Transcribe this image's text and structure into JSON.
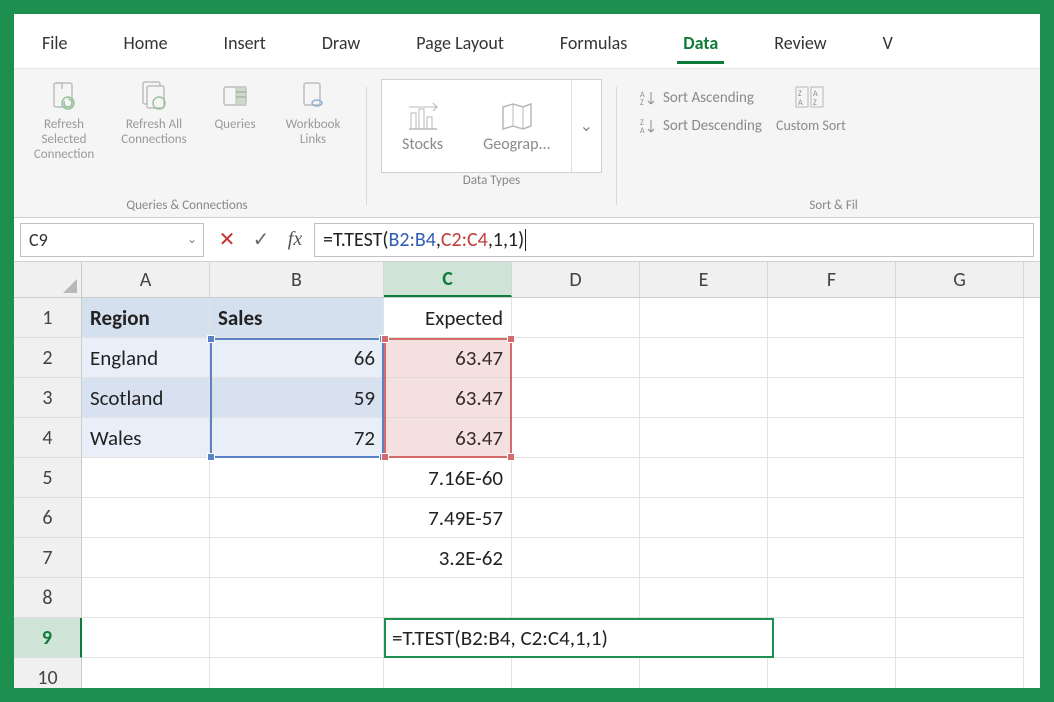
{
  "tabs": {
    "file": "File",
    "home": "Home",
    "insert": "Insert",
    "draw": "Draw",
    "page_layout": "Page Layout",
    "formulas": "Formulas",
    "data": "Data",
    "review": "Review",
    "view_partial": "V"
  },
  "active_tab": "Data",
  "ribbon": {
    "queries": {
      "refresh_selected": "Refresh Selected Connection",
      "refresh_all": "Refresh All Connections",
      "queries": "Queries",
      "workbook_links": "Workbook Links",
      "group_label": "Queries & Connections"
    },
    "datatypes": {
      "stocks": "Stocks",
      "geography": "Geograp...",
      "group_label": "Data Types"
    },
    "sort": {
      "ascending": "Sort Ascending",
      "descending": "Sort Descending",
      "custom": "Custom Sort",
      "group_label": "Sort & Fil"
    }
  },
  "formula_bar": {
    "name_box": "C9",
    "formula_prefix": "=T.TEST(",
    "ref_b": "B2:B4",
    "sep1": ", ",
    "ref_c": "C2:C4",
    "suffix": ",1,1)"
  },
  "columns": [
    "A",
    "B",
    "C",
    "D",
    "E",
    "F",
    "G"
  ],
  "rows": [
    "1",
    "2",
    "3",
    "4",
    "5",
    "6",
    "7",
    "8",
    "9",
    "10"
  ],
  "selected_col": "C",
  "selected_row": "9",
  "sheet": {
    "A1": "Region",
    "B1": "Sales",
    "C1": "Expected",
    "A2": "England",
    "B2": "66",
    "C2": "63.47",
    "A3": "Scotland",
    "B3": "59",
    "C3": "63.47",
    "A4": "Wales",
    "B4": "72",
    "C4": "63.47",
    "C5": "7.16E-60",
    "C6": "7.49E-57",
    "C7": "3.2E-62",
    "C9": "=T.TEST(B2:B4, C2:C4,1,1)"
  },
  "chart_data": {
    "type": "table",
    "title": "",
    "columns": [
      "Region",
      "Sales",
      "Expected"
    ],
    "rows": [
      [
        "England",
        66,
        63.47
      ],
      [
        "Scotland",
        59,
        63.47
      ],
      [
        "Wales",
        72,
        63.47
      ]
    ],
    "extra_column_C": {
      "C5": 7.16e-60,
      "C6": 7.49e-57,
      "C7": 3.2e-62
    },
    "formula_cell": {
      "ref": "C9",
      "formula": "=T.TEST(B2:B4, C2:C4,1,1)"
    }
  }
}
